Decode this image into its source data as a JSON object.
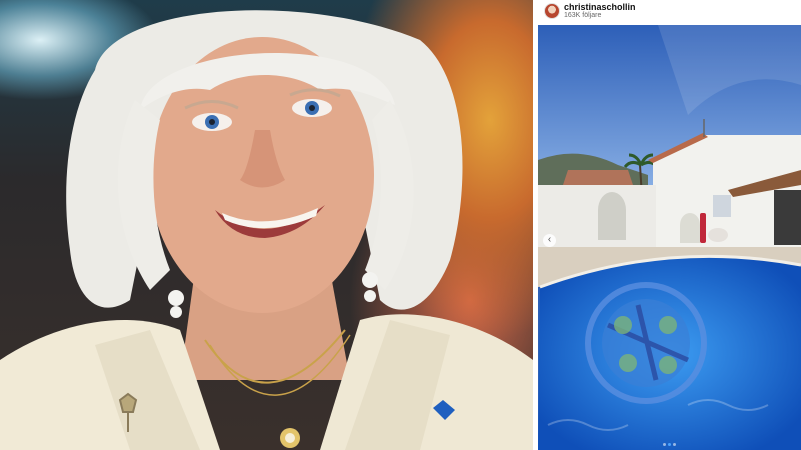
{
  "instagram_post": {
    "username": "christinaschollin",
    "followers": "163K följare",
    "avatar_icon": "profile-avatar",
    "prev_icon": "chevron-left-icon",
    "carousel": {
      "count": 3,
      "active": 2
    }
  },
  "colors": {
    "pool_water": "#1e6fd9",
    "sky": "#3b6fc6",
    "jacket": "#f1ead6"
  }
}
